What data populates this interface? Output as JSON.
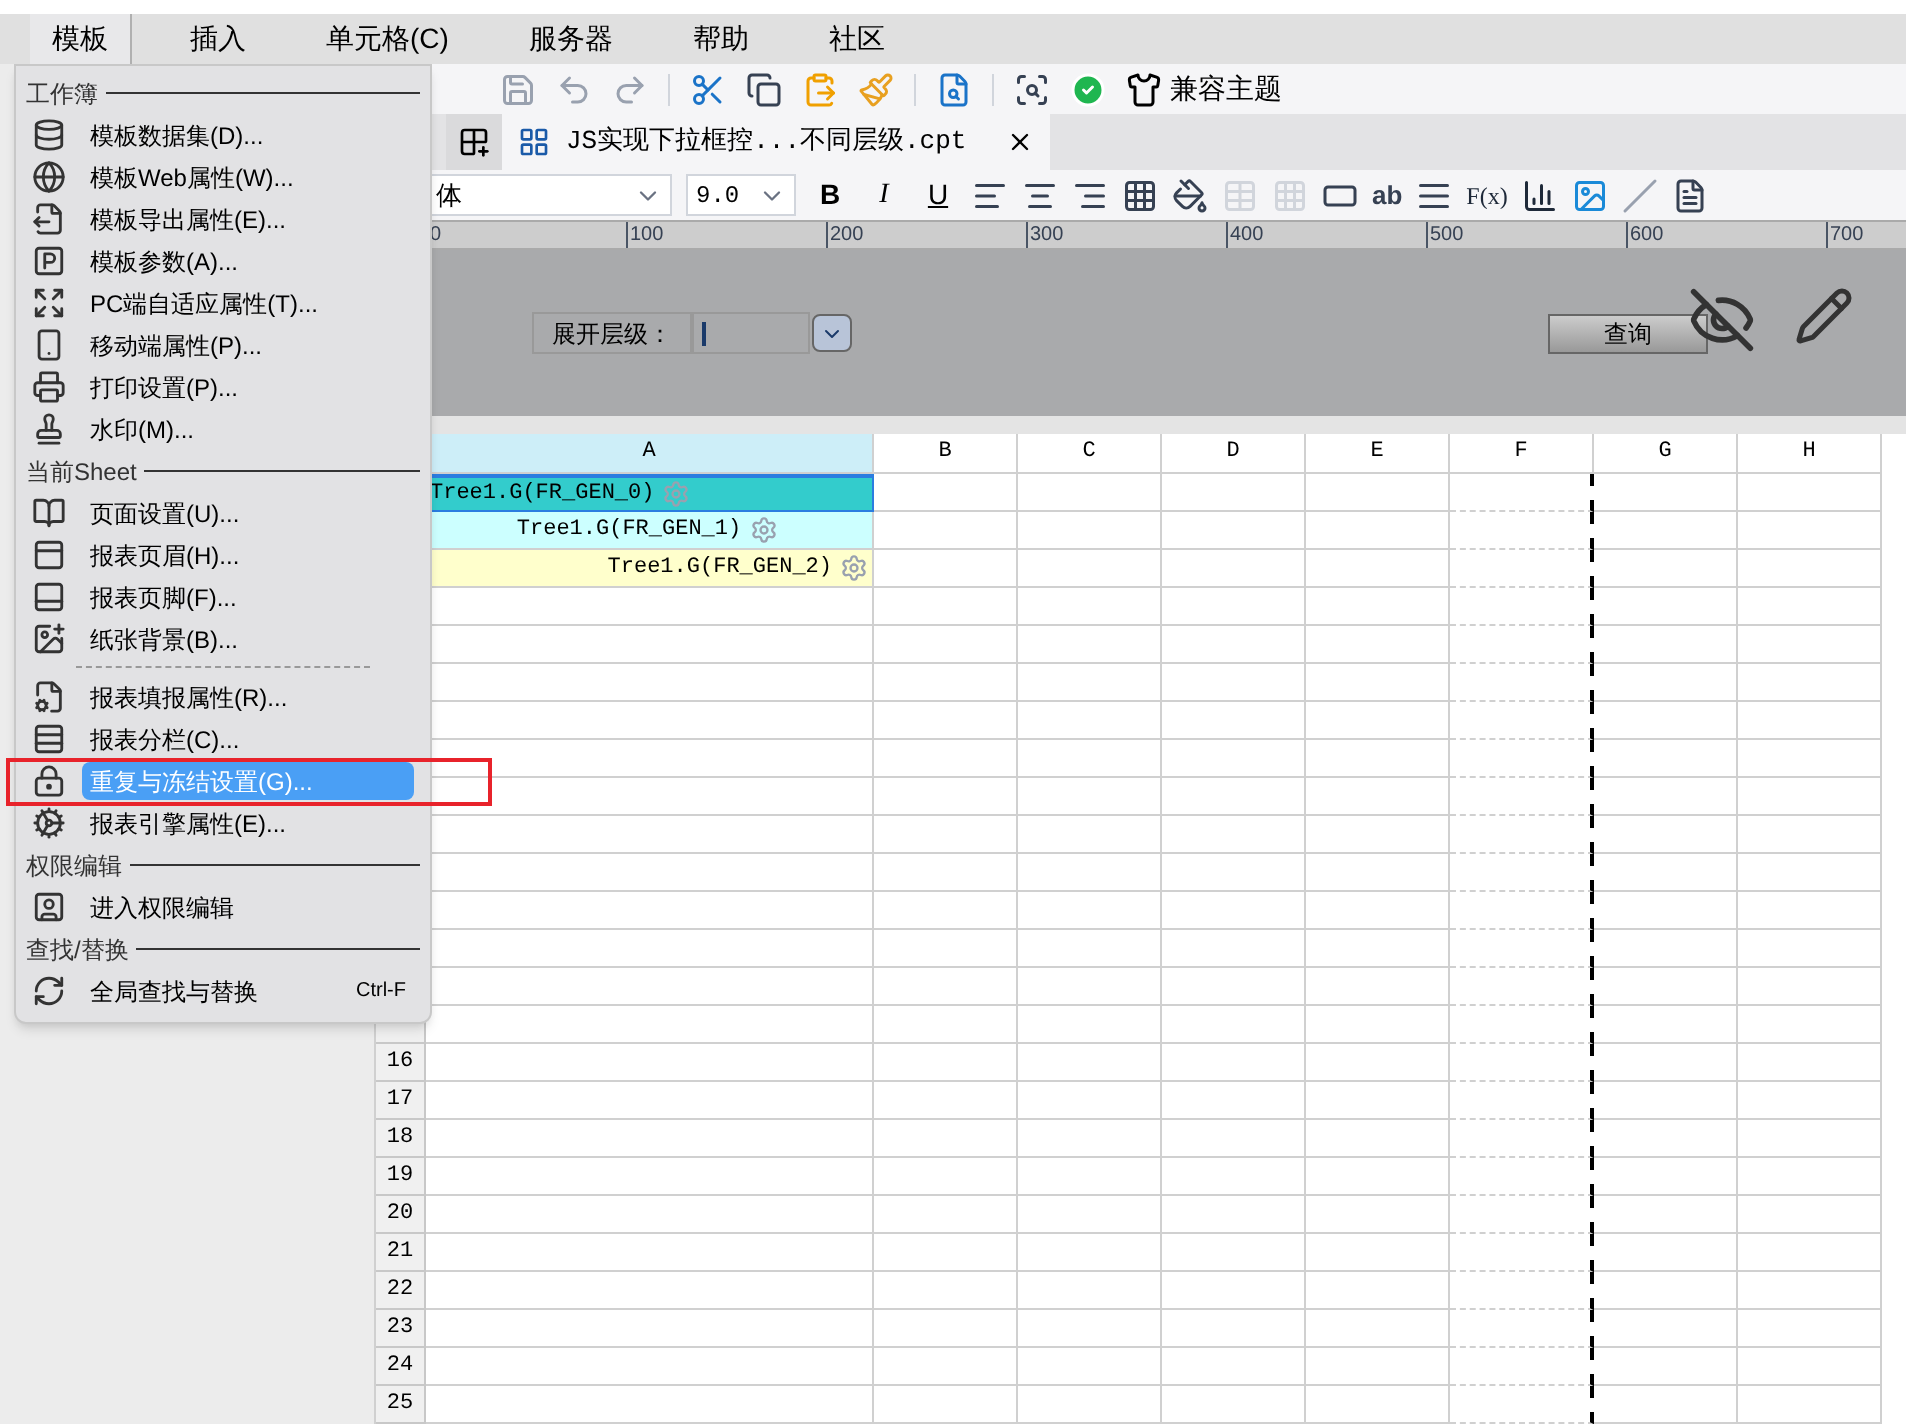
{
  "menubar": [
    {
      "label": "模板",
      "selected": true
    },
    {
      "label": "插入",
      "selected": false
    },
    {
      "label": "单元格(C)",
      "selected": false
    },
    {
      "label": "服务器",
      "selected": false
    },
    {
      "label": "帮助",
      "selected": false
    },
    {
      "label": "社区",
      "selected": false
    }
  ],
  "toolbar": {
    "theme_button": "兼容主题"
  },
  "tabs": [
    {
      "label": "JS实现下拉框控...不同层级.cpt",
      "selected": true
    }
  ],
  "format_toolbar": {
    "font": "体",
    "size": "9.0",
    "bold": "B",
    "italic": "I",
    "underline": "U",
    "text_tool": "ab",
    "formula_tool": "F(x)"
  },
  "ruler": [
    "0",
    "100",
    "200",
    "300",
    "400",
    "500",
    "600",
    "700"
  ],
  "parameter_pane": {
    "label": "展开层级：",
    "query_button": "查询"
  },
  "grid": {
    "columns": [
      {
        "label": "A",
        "selected": true
      },
      {
        "label": "B",
        "selected": false
      },
      {
        "label": "C",
        "selected": false
      },
      {
        "label": "D",
        "selected": false
      },
      {
        "label": "E",
        "selected": false
      },
      {
        "label": "F",
        "selected": false
      },
      {
        "label": "G",
        "selected": false
      },
      {
        "label": "H",
        "selected": false
      }
    ],
    "cells": [
      {
        "text": "Tree1.G(FR_GEN_0)",
        "color": "#33cccc",
        "kind": "left",
        "selected": true
      },
      {
        "text": "Tree1.G(FR_GEN_1)",
        "color": "#ccffff",
        "kind": "center",
        "selected": false
      },
      {
        "text": "Tree1.G(FR_GEN_2)",
        "color": "#ffffcc",
        "kind": "right",
        "selected": false
      }
    ],
    "row_numbers": [
      "16",
      "17",
      "18",
      "19",
      "20",
      "21",
      "22",
      "23",
      "24",
      "25"
    ]
  },
  "menu": {
    "sections": [
      {
        "heading": "工作簿",
        "items": [
          {
            "kind": "item",
            "label": "模板数据集(D)...",
            "selected": false
          },
          {
            "kind": "item",
            "label": "模板Web属性(W)...",
            "selected": false
          },
          {
            "kind": "item",
            "label": "模板导出属性(E)...",
            "selected": false
          },
          {
            "kind": "item",
            "label": "模板参数(A)...",
            "selected": false
          },
          {
            "kind": "item",
            "label": "PC端自适应属性(T)...",
            "selected": false
          },
          {
            "kind": "item",
            "label": "移动端属性(P)...",
            "selected": false
          },
          {
            "kind": "item",
            "label": "打印设置(P)...",
            "selected": false
          },
          {
            "kind": "item",
            "label": "水印(M)...",
            "selected": false
          }
        ]
      },
      {
        "heading": "当前Sheet",
        "items": [
          {
            "kind": "item",
            "label": "页面设置(U)...",
            "selected": false
          },
          {
            "kind": "item",
            "label": "报表页眉(H)...",
            "selected": false
          },
          {
            "kind": "item",
            "label": "报表页脚(F)...",
            "selected": false
          },
          {
            "kind": "item",
            "label": "纸张背景(B)...",
            "selected": false
          },
          {
            "kind": "divider"
          },
          {
            "kind": "item",
            "label": "报表填报属性(R)...",
            "selected": false
          },
          {
            "kind": "item",
            "label": "报表分栏(C)...",
            "selected": false
          },
          {
            "kind": "item",
            "label": "重复与冻结设置(G)...",
            "selected": true
          },
          {
            "kind": "item",
            "label": "报表引擎属性(E)...",
            "selected": false
          }
        ]
      },
      {
        "heading": "权限编辑",
        "items": [
          {
            "kind": "item",
            "label": "进入权限编辑",
            "selected": false
          }
        ]
      },
      {
        "heading": "查找/替换",
        "items": [
          {
            "kind": "item",
            "label": "全局查找与替换",
            "shortcut": "Ctrl-F",
            "selected": false
          }
        ]
      }
    ]
  }
}
